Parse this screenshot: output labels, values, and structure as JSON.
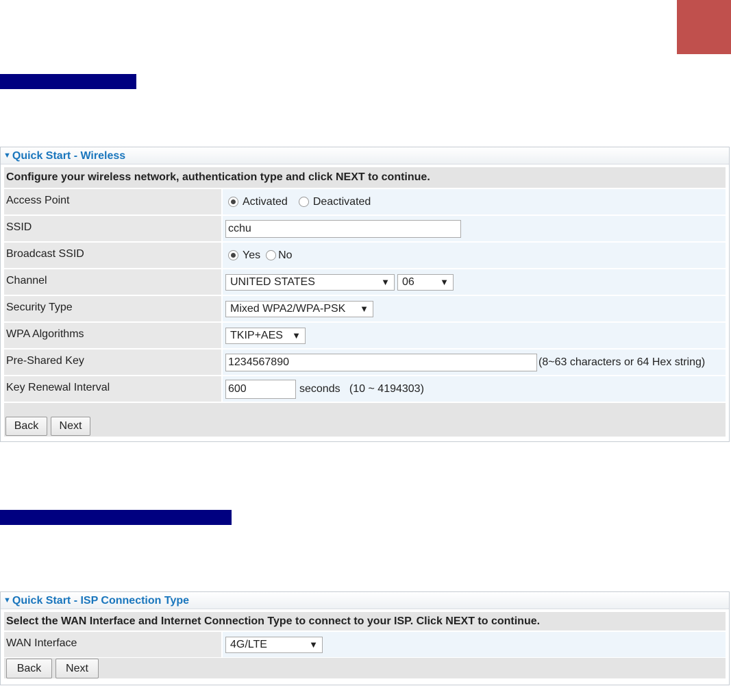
{
  "colors": {
    "heading_bar": "#000080",
    "corner_tab": "#c0504d",
    "panel_title": "#1a76bd"
  },
  "wireless": {
    "title": "Quick Start - Wireless",
    "description": "Configure your wireless network, authentication type and click NEXT to continue.",
    "access_point": {
      "label": "Access Point",
      "options": [
        "Activated",
        "Deactivated"
      ],
      "selected": "Activated"
    },
    "ssid": {
      "label": "SSID",
      "value": "cchu"
    },
    "broadcast_ssid": {
      "label": "Broadcast SSID",
      "options": [
        "Yes",
        "No"
      ],
      "selected": "Yes"
    },
    "channel": {
      "label": "Channel",
      "country": "UNITED STATES",
      "number": "06"
    },
    "security_type": {
      "label": "Security Type",
      "value": "Mixed WPA2/WPA-PSK"
    },
    "wpa_algorithms": {
      "label": "WPA Algorithms",
      "value": "TKIP+AES"
    },
    "psk": {
      "label": "Pre-Shared Key",
      "value": "1234567890",
      "hint": "(8~63 characters or 64 Hex string)"
    },
    "key_renewal": {
      "label": "Key Renewal Interval",
      "value": "600",
      "hint": "seconds   (10 ~ 4194303)"
    },
    "back_label": "Back",
    "next_label": "Next"
  },
  "isp": {
    "title": "Quick Start - ISP Connection Type",
    "description": "Select the WAN Interface and Internet Connection Type to connect to your ISP. Click NEXT to continue.",
    "wan_interface": {
      "label": "WAN Interface",
      "value": "4G/LTE"
    },
    "back_label": "Back",
    "next_label": "Next"
  }
}
